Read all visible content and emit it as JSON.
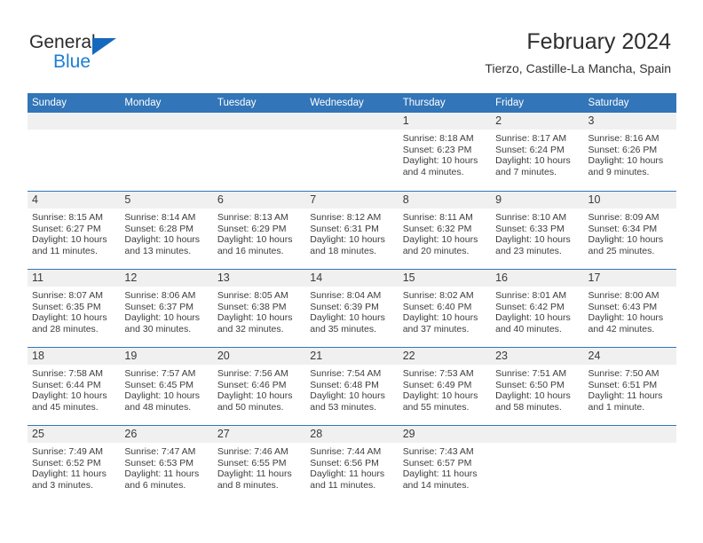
{
  "brand": {
    "line1": "General",
    "line2": "Blue",
    "mark": "triangle-logo-mark",
    "accent_color": "#1569bd",
    "text_color": "#2b2b2b"
  },
  "header": {
    "title": "February 2024",
    "subtitle": "Tierzo, Castille-La Mancha, Spain"
  },
  "theme": {
    "header_blue": "#3275b8",
    "day_band_gray": "#f0f0f0",
    "body_text": "#3d3d3d"
  },
  "weekdays": [
    "Sunday",
    "Monday",
    "Tuesday",
    "Wednesday",
    "Thursday",
    "Friday",
    "Saturday"
  ],
  "weeks": [
    [
      {
        "day": "",
        "sunrise": "",
        "sunset": "",
        "daylight_line1": "",
        "daylight_line2": ""
      },
      {
        "day": "",
        "sunrise": "",
        "sunset": "",
        "daylight_line1": "",
        "daylight_line2": ""
      },
      {
        "day": "",
        "sunrise": "",
        "sunset": "",
        "daylight_line1": "",
        "daylight_line2": ""
      },
      {
        "day": "",
        "sunrise": "",
        "sunset": "",
        "daylight_line1": "",
        "daylight_line2": ""
      },
      {
        "day": "1",
        "sunrise": "Sunrise: 8:18 AM",
        "sunset": "Sunset: 6:23 PM",
        "daylight_line1": "Daylight: 10 hours",
        "daylight_line2": "and 4 minutes."
      },
      {
        "day": "2",
        "sunrise": "Sunrise: 8:17 AM",
        "sunset": "Sunset: 6:24 PM",
        "daylight_line1": "Daylight: 10 hours",
        "daylight_line2": "and 7 minutes."
      },
      {
        "day": "3",
        "sunrise": "Sunrise: 8:16 AM",
        "sunset": "Sunset: 6:26 PM",
        "daylight_line1": "Daylight: 10 hours",
        "daylight_line2": "and 9 minutes."
      }
    ],
    [
      {
        "day": "4",
        "sunrise": "Sunrise: 8:15 AM",
        "sunset": "Sunset: 6:27 PM",
        "daylight_line1": "Daylight: 10 hours",
        "daylight_line2": "and 11 minutes."
      },
      {
        "day": "5",
        "sunrise": "Sunrise: 8:14 AM",
        "sunset": "Sunset: 6:28 PM",
        "daylight_line1": "Daylight: 10 hours",
        "daylight_line2": "and 13 minutes."
      },
      {
        "day": "6",
        "sunrise": "Sunrise: 8:13 AM",
        "sunset": "Sunset: 6:29 PM",
        "daylight_line1": "Daylight: 10 hours",
        "daylight_line2": "and 16 minutes."
      },
      {
        "day": "7",
        "sunrise": "Sunrise: 8:12 AM",
        "sunset": "Sunset: 6:31 PM",
        "daylight_line1": "Daylight: 10 hours",
        "daylight_line2": "and 18 minutes."
      },
      {
        "day": "8",
        "sunrise": "Sunrise: 8:11 AM",
        "sunset": "Sunset: 6:32 PM",
        "daylight_line1": "Daylight: 10 hours",
        "daylight_line2": "and 20 minutes."
      },
      {
        "day": "9",
        "sunrise": "Sunrise: 8:10 AM",
        "sunset": "Sunset: 6:33 PM",
        "daylight_line1": "Daylight: 10 hours",
        "daylight_line2": "and 23 minutes."
      },
      {
        "day": "10",
        "sunrise": "Sunrise: 8:09 AM",
        "sunset": "Sunset: 6:34 PM",
        "daylight_line1": "Daylight: 10 hours",
        "daylight_line2": "and 25 minutes."
      }
    ],
    [
      {
        "day": "11",
        "sunrise": "Sunrise: 8:07 AM",
        "sunset": "Sunset: 6:35 PM",
        "daylight_line1": "Daylight: 10 hours",
        "daylight_line2": "and 28 minutes."
      },
      {
        "day": "12",
        "sunrise": "Sunrise: 8:06 AM",
        "sunset": "Sunset: 6:37 PM",
        "daylight_line1": "Daylight: 10 hours",
        "daylight_line2": "and 30 minutes."
      },
      {
        "day": "13",
        "sunrise": "Sunrise: 8:05 AM",
        "sunset": "Sunset: 6:38 PM",
        "daylight_line1": "Daylight: 10 hours",
        "daylight_line2": "and 32 minutes."
      },
      {
        "day": "14",
        "sunrise": "Sunrise: 8:04 AM",
        "sunset": "Sunset: 6:39 PM",
        "daylight_line1": "Daylight: 10 hours",
        "daylight_line2": "and 35 minutes."
      },
      {
        "day": "15",
        "sunrise": "Sunrise: 8:02 AM",
        "sunset": "Sunset: 6:40 PM",
        "daylight_line1": "Daylight: 10 hours",
        "daylight_line2": "and 37 minutes."
      },
      {
        "day": "16",
        "sunrise": "Sunrise: 8:01 AM",
        "sunset": "Sunset: 6:42 PM",
        "daylight_line1": "Daylight: 10 hours",
        "daylight_line2": "and 40 minutes."
      },
      {
        "day": "17",
        "sunrise": "Sunrise: 8:00 AM",
        "sunset": "Sunset: 6:43 PM",
        "daylight_line1": "Daylight: 10 hours",
        "daylight_line2": "and 42 minutes."
      }
    ],
    [
      {
        "day": "18",
        "sunrise": "Sunrise: 7:58 AM",
        "sunset": "Sunset: 6:44 PM",
        "daylight_line1": "Daylight: 10 hours",
        "daylight_line2": "and 45 minutes."
      },
      {
        "day": "19",
        "sunrise": "Sunrise: 7:57 AM",
        "sunset": "Sunset: 6:45 PM",
        "daylight_line1": "Daylight: 10 hours",
        "daylight_line2": "and 48 minutes."
      },
      {
        "day": "20",
        "sunrise": "Sunrise: 7:56 AM",
        "sunset": "Sunset: 6:46 PM",
        "daylight_line1": "Daylight: 10 hours",
        "daylight_line2": "and 50 minutes."
      },
      {
        "day": "21",
        "sunrise": "Sunrise: 7:54 AM",
        "sunset": "Sunset: 6:48 PM",
        "daylight_line1": "Daylight: 10 hours",
        "daylight_line2": "and 53 minutes."
      },
      {
        "day": "22",
        "sunrise": "Sunrise: 7:53 AM",
        "sunset": "Sunset: 6:49 PM",
        "daylight_line1": "Daylight: 10 hours",
        "daylight_line2": "and 55 minutes."
      },
      {
        "day": "23",
        "sunrise": "Sunrise: 7:51 AM",
        "sunset": "Sunset: 6:50 PM",
        "daylight_line1": "Daylight: 10 hours",
        "daylight_line2": "and 58 minutes."
      },
      {
        "day": "24",
        "sunrise": "Sunrise: 7:50 AM",
        "sunset": "Sunset: 6:51 PM",
        "daylight_line1": "Daylight: 11 hours",
        "daylight_line2": "and 1 minute."
      }
    ],
    [
      {
        "day": "25",
        "sunrise": "Sunrise: 7:49 AM",
        "sunset": "Sunset: 6:52 PM",
        "daylight_line1": "Daylight: 11 hours",
        "daylight_line2": "and 3 minutes."
      },
      {
        "day": "26",
        "sunrise": "Sunrise: 7:47 AM",
        "sunset": "Sunset: 6:53 PM",
        "daylight_line1": "Daylight: 11 hours",
        "daylight_line2": "and 6 minutes."
      },
      {
        "day": "27",
        "sunrise": "Sunrise: 7:46 AM",
        "sunset": "Sunset: 6:55 PM",
        "daylight_line1": "Daylight: 11 hours",
        "daylight_line2": "and 8 minutes."
      },
      {
        "day": "28",
        "sunrise": "Sunrise: 7:44 AM",
        "sunset": "Sunset: 6:56 PM",
        "daylight_line1": "Daylight: 11 hours",
        "daylight_line2": "and 11 minutes."
      },
      {
        "day": "29",
        "sunrise": "Sunrise: 7:43 AM",
        "sunset": "Sunset: 6:57 PM",
        "daylight_line1": "Daylight: 11 hours",
        "daylight_line2": "and 14 minutes."
      },
      {
        "day": "",
        "sunrise": "",
        "sunset": "",
        "daylight_line1": "",
        "daylight_line2": ""
      },
      {
        "day": "",
        "sunrise": "",
        "sunset": "",
        "daylight_line1": "",
        "daylight_line2": ""
      }
    ]
  ]
}
